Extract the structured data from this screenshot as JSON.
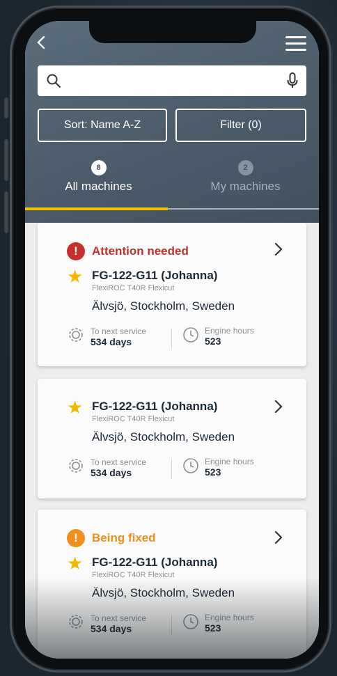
{
  "header": {
    "back_icon": "chevron-left-icon",
    "menu_icon": "hamburger-menu-icon"
  },
  "search": {
    "value": "",
    "placeholder": ""
  },
  "toolbar": {
    "sort_label": "Sort: Name A-Z",
    "filter_label": "Filter (0)"
  },
  "tabs": [
    {
      "label": "All machines",
      "count": "8",
      "active": true
    },
    {
      "label": "My machines",
      "count": "2",
      "active": false
    }
  ],
  "colors": {
    "accent": "#f2c200",
    "attention": "#c4302b",
    "fixing": "#f0901c",
    "star": "#f6b800",
    "header_bg": "#4a5a68"
  },
  "cards": [
    {
      "status": "Attention needed",
      "status_type": "attention",
      "name": "FG-122-G11 (Johanna)",
      "model": "FlexiROC T40R Flexicut",
      "location": "Älvsjö, Stockholm, Sweden",
      "service_label": "To next service",
      "service_value": "534 days",
      "hours_label": "Engine hours",
      "hours_value": "523"
    },
    {
      "status": "",
      "status_type": "none",
      "name": "FG-122-G11 (Johanna)",
      "model": "FlexiROC T40R Flexicut",
      "location": "Älvsjö, Stockholm, Sweden",
      "service_label": "To next service",
      "service_value": "534 days",
      "hours_label": "Engine hours",
      "hours_value": "523"
    },
    {
      "status": "Being fixed",
      "status_type": "fixing",
      "name": "FG-122-G11 (Johanna)",
      "model": "FlexiROC T40R Flexicut",
      "location": "Älvsjö, Stockholm, Sweden",
      "service_label": "To next service",
      "service_value": "534 days",
      "hours_label": "Engine hours",
      "hours_value": "523"
    }
  ]
}
